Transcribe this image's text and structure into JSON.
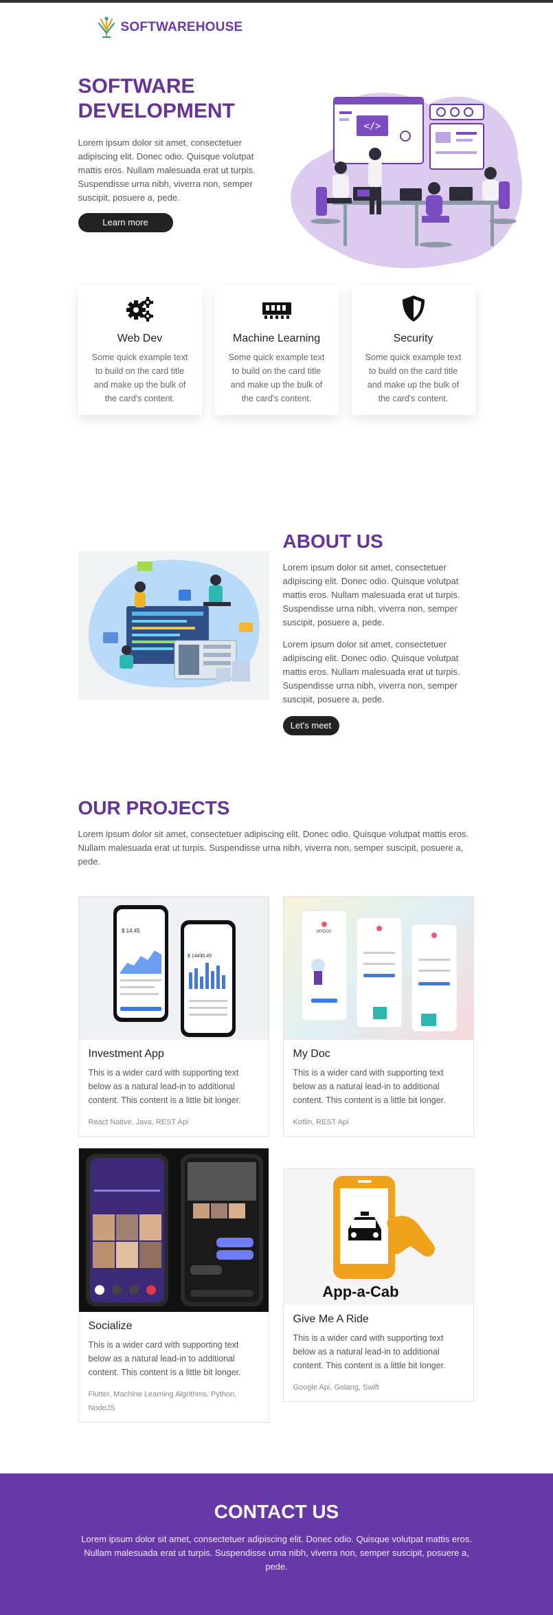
{
  "nav": {
    "brand": "SOFTWAREHOUSE"
  },
  "hero": {
    "title": "SOFTWARE DEVELOPMENT",
    "text": "Lorem ipsum dolor sit amet, consectetuer adipiscing elit. Donec odio. Quisque volutpat mattis eros. Nullam malesuada erat ut turpis. Suspendisse urna nibh, viverra non, semper suscipit, posuere a, pede.",
    "button": "Learn more"
  },
  "features": [
    {
      "icon": "gears-icon",
      "title": "Web Dev",
      "text": "Some quick example text to build on the card title and make up the bulk of the card's content."
    },
    {
      "icon": "memory-chip-icon",
      "title": "Machine Learning",
      "text": "Some quick example text to build on the card title and make up the bulk of the card's content."
    },
    {
      "icon": "shield-icon",
      "title": "Security",
      "text": "Some quick example text to build on the card title and make up the bulk of the card's content."
    }
  ],
  "about": {
    "title": "ABOUT US",
    "p1": "Lorem ipsum dolor sit amet, consectetuer adipiscing elit. Donec odio. Quisque volutpat mattis eros. Nullam malesuada erat ut turpis. Suspendisse urna nibh, viverra non, semper suscipit, posuere a, pede.",
    "p2": "Lorem ipsum dolor sit amet, consectetuer adipiscing elit. Donec odio. Quisque volutpat mattis eros. Nullam malesuada erat ut turpis. Suspendisse urna nibh, viverra non, semper suscipit, posuere a, pede.",
    "button": "Let's meet"
  },
  "projects": {
    "title": "OUR PROJECTS",
    "text": "Lorem ipsum dolor sit amet, consectetuer adipiscing elit. Donec odio. Quisque volutpat mattis eros. Nullam malesuada erat ut turpis. Suspendisse urna nibh, viverra non, semper suscipit, posuere a, pede.",
    "items": [
      {
        "title": "Investment App",
        "text": "This is a wider card with supporting text below as a natural lead-in to additional content. This content is a little bit longer.",
        "tech": "React Native, Java, REST Api",
        "screen1_amount": "$ 14.45",
        "screen2_amount": "$ 14430.45"
      },
      {
        "title": "My Doc",
        "text": "This is a wider card with supporting text below as a natural lead-in to additional content. This content is a little bit longer.",
        "tech": "Kotlin, REST Api",
        "logo_text": "MYDOC"
      },
      {
        "title": "Socialize",
        "text": "This is a wider card with supporting text below as a natural lead-in to additional content. This content is a little bit longer.",
        "tech": "Flutter, Machine Learning Algrithms, Python, NodeJS"
      },
      {
        "title": "Give Me A Ride",
        "text": "This is a wider card with supporting text below as a natural lead-in to additional content. This content is a little bit longer.",
        "tech": "Google Api, Golang, Swift",
        "logo_text": "App-a-Cab"
      }
    ]
  },
  "contact": {
    "title": "CONTACT US",
    "text": "Lorem ipsum dolor sit amet, consectetuer adipiscing elit. Donec odio. Quisque volutpat mattis eros. Nullam malesuada erat ut turpis. Suspendisse urna nibh, viverra non, semper suscipit, posuere a, pede."
  },
  "colors": {
    "brand": "#663399",
    "dark": "#222222",
    "contact_bg": "#6738a8",
    "accent_orange": "#f0a21b"
  }
}
